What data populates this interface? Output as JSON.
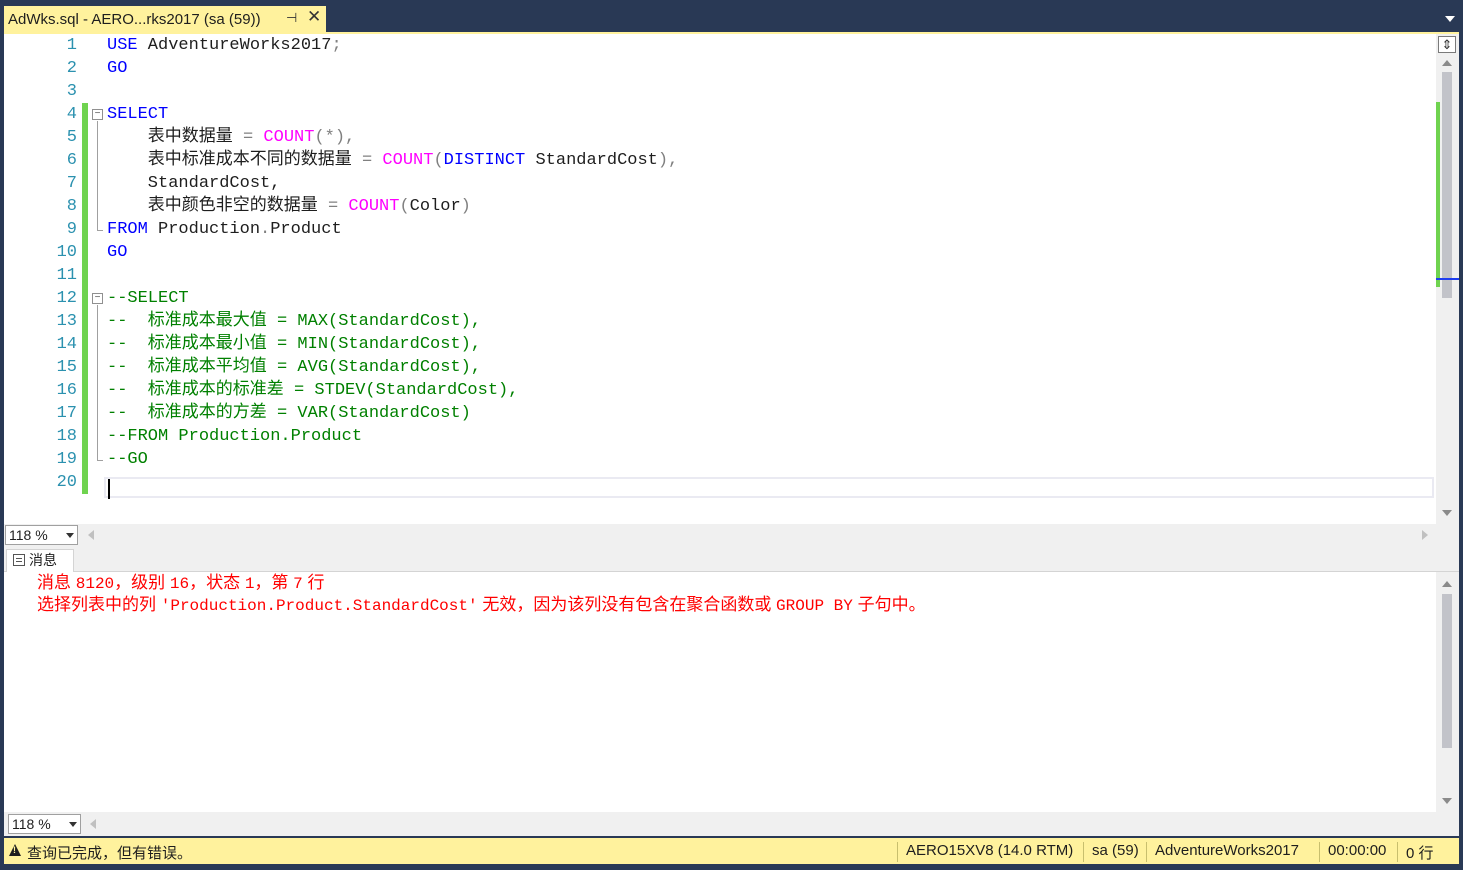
{
  "tab": {
    "title": "AdWks.sql - AERO...rks2017 (sa (59))",
    "pin_icon": "pin-icon",
    "close_label": "✕"
  },
  "editor": {
    "lines": [
      {
        "n": "1"
      },
      {
        "n": "2"
      },
      {
        "n": "3"
      },
      {
        "n": "4"
      },
      {
        "n": "5"
      },
      {
        "n": "6"
      },
      {
        "n": "7"
      },
      {
        "n": "8"
      },
      {
        "n": "9"
      },
      {
        "n": "10"
      },
      {
        "n": "11"
      },
      {
        "n": "12"
      },
      {
        "n": "13"
      },
      {
        "n": "14"
      },
      {
        "n": "15"
      },
      {
        "n": "16"
      },
      {
        "n": "17"
      },
      {
        "n": "18"
      },
      {
        "n": "19"
      },
      {
        "n": "20"
      }
    ],
    "code": {
      "l1_kw": "USE",
      "l1_rest": " AdventureWorks2017",
      "l1_semi": ";",
      "l2": "GO",
      "l4": "SELECT",
      "l5_a": "    表中数据量 ",
      "l5_eq": "=",
      "l5_fn": "COUNT",
      "l5_args": "(*),",
      "l6_a": "    表中标准成本不同的数据量 ",
      "l6_eq": "=",
      "l6_fn": "COUNT",
      "l6_p": "(",
      "l6_kw": "DISTINCT",
      "l6_b": " StandardCost",
      "l6_end": "),",
      "l7": "    StandardCost,",
      "l8_a": "    表中颜色非空的数据量 ",
      "l8_eq": "=",
      "l8_fn": "COUNT",
      "l8_p1": "(",
      "l8_b": "Color",
      "l8_p2": ")",
      "l9_kw": "FROM",
      "l9_rest": " Production",
      "l9_dot": ".",
      "l9_tbl": "Product",
      "l10": "GO",
      "l12": "--SELECT",
      "l13": "--  标准成本最大值 = MAX(StandardCost),",
      "l14": "--  标准成本最小值 = MIN(StandardCost),",
      "l15": "--  标准成本平均值 = AVG(StandardCost),",
      "l16": "--  标准成本的标准差 = STDEV(StandardCost),",
      "l17": "--  标准成本的方差 = VAR(StandardCost)",
      "l18": "--FROM Production.Product",
      "l19": "--GO"
    },
    "zoom": "118 %"
  },
  "results": {
    "tab_label": "消息",
    "line1_a": "消息 ",
    "line1_b": "8120",
    "line1_c": "，级别 ",
    "line1_d": "16",
    "line1_e": "，状态 ",
    "line1_f": "1",
    "line1_g": "，第 ",
    "line1_h": "7",
    "line1_i": " 行",
    "line2_a": "选择列表中的列 ",
    "line2_b": "'Production.Product.StandardCost'",
    "line2_c": " 无效，因为该列没有包含在聚合函数或 ",
    "line2_d": "GROUP BY",
    "line2_e": " 子句中。",
    "zoom": "118 %"
  },
  "status": {
    "message": "查询已完成，但有错误。",
    "server": "AERO15XV8 (14.0 RTM)",
    "user": "sa (59)",
    "database": "AdventureWorks2017",
    "elapsed": "00:00:00",
    "rows": "0 行"
  },
  "colors": {
    "tab_accent": "#fff29d",
    "keyword": "#0000ff",
    "function": "#ff00ff",
    "comment": "#008000",
    "error": "#ff0000",
    "line_number": "#2b91af",
    "change_bar": "#6fd34f"
  }
}
